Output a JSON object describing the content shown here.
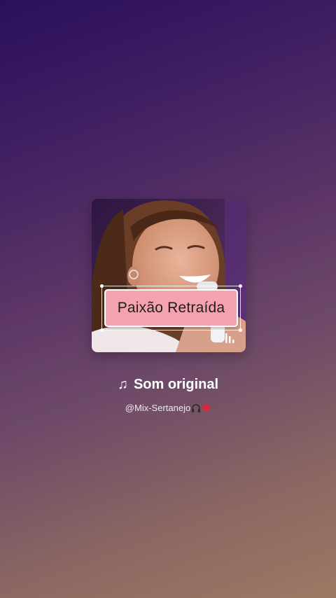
{
  "cover": {
    "sticker_text": "Paixão Retraída"
  },
  "sound": {
    "note_icon": "♫",
    "title": "Som original",
    "author": "@Mix-Sertanejo",
    "author_emojis": [
      "headphones-icon",
      "red-heart-icon"
    ]
  },
  "colors": {
    "sticker_bg": "#f4a3ae",
    "bg_top": "#2a0f5c",
    "bg_bottom": "#9b7a64",
    "heart": "#e0243c"
  }
}
